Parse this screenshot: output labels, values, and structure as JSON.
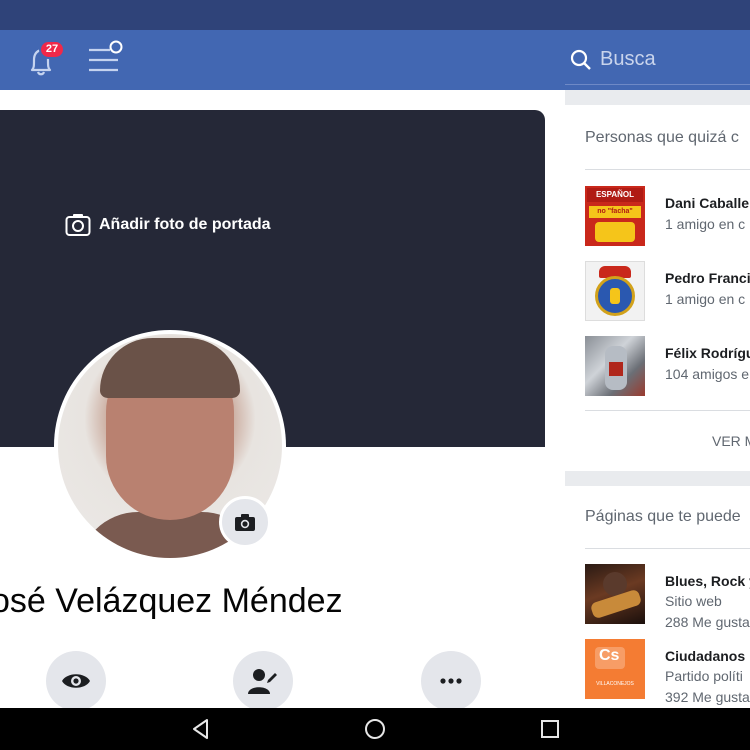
{
  "topbar": {
    "notification_count": "27",
    "search_placeholder": "Busca"
  },
  "profile": {
    "add_cover_label": "Añadir foto de portada",
    "name": "osé Velázquez Méndez"
  },
  "people_card": {
    "title": "Personas que quizá c",
    "items": [
      {
        "name": "Dani Caballe",
        "mutual": "1 amigo en c"
      },
      {
        "name": "Pedro Franci",
        "mutual": "1 amigo en c"
      },
      {
        "name": "Félix Rodrígu",
        "mutual": "104 amigos e"
      }
    ],
    "see_more": "VER M",
    "thumb1_lines": [
      "ESPAÑOL",
      "no \"facha\""
    ]
  },
  "pages_card": {
    "title": "Páginas que te puede",
    "items": [
      {
        "name": "Blues, Rock y",
        "category": "Sitio web",
        "likes": "288 Me gusta"
      },
      {
        "name": "Ciudadanos",
        "category": "Partido políti",
        "likes": "392 Me gusta"
      }
    ],
    "cs_logo": "Cs",
    "cs_sub": "VILLACONEJOS"
  },
  "colors": {
    "topbar": "#4267b2",
    "statusbar": "#2f4379",
    "cover": "#252837",
    "badge": "#f02849",
    "cs_orange": "#f47c33"
  }
}
